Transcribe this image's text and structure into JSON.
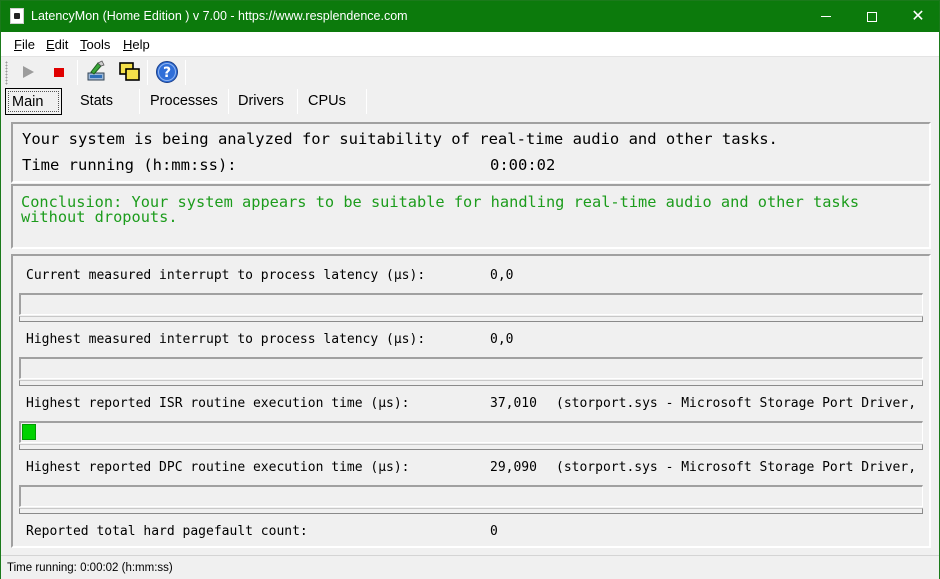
{
  "window": {
    "title": "LatencyMon  (Home Edition )  v 7.00 - https://www.resplendence.com",
    "accent_color": "#0c7a0c"
  },
  "menu": {
    "items": [
      "File",
      "Edit",
      "Tools",
      "Help"
    ]
  },
  "toolbar": {
    "icons": [
      "play-icon",
      "stop-icon",
      "tool-icon",
      "windows-icon",
      "help-icon"
    ]
  },
  "tabs": [
    {
      "label": "Main",
      "active": true
    },
    {
      "label": "Stats",
      "active": false
    },
    {
      "label": "Processes",
      "active": false
    },
    {
      "label": "Drivers",
      "active": false
    },
    {
      "label": "CPUs",
      "active": false
    }
  ],
  "status": {
    "analyzing_text": "Your system is being analyzed for suitability of real-time audio and other tasks.",
    "time_running_label": "Time running (h:mm:ss):",
    "time_running_value": "0:00:02"
  },
  "conclusion": {
    "text": "Conclusion: Your system appears to be suitable for handling real-time audio and other tasks without dropouts.",
    "color": "#1c9c1c"
  },
  "metrics": [
    {
      "label": "Current measured interrupt to process latency (µs):",
      "value": "0,0",
      "detail": "",
      "bar_fraction": 0
    },
    {
      "label": "Highest measured interrupt to process latency (µs):",
      "value": "0,0",
      "detail": "",
      "bar_fraction": 0
    },
    {
      "label": "Highest reported ISR routine execution time (µs):",
      "value": "37,010",
      "detail": "(storport.sys - Microsoft Storage Port Driver,",
      "bar_fraction": 0.015
    },
    {
      "label": "Highest reported DPC routine execution time (µs):",
      "value": "29,090",
      "detail": "(storport.sys - Microsoft Storage Port Driver,",
      "bar_fraction": 0
    },
    {
      "label": "Reported total hard pagefault count:",
      "value": "0",
      "detail": ""
    }
  ],
  "statusbar": {
    "text": "Time running: 0:00:02  (h:mm:ss)"
  }
}
